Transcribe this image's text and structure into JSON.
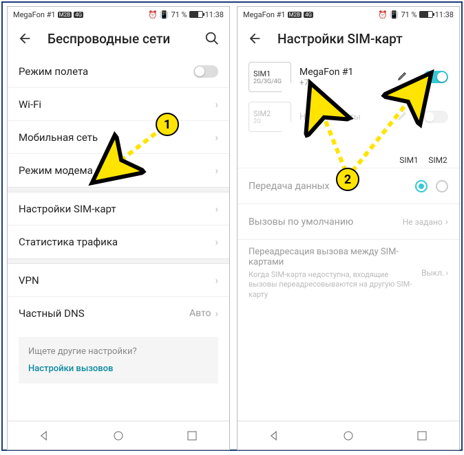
{
  "statusbar": {
    "carrier": "MegaFon #1",
    "badge1": "M2B",
    "badge2": "4G",
    "battery_pct": "71 %",
    "time": "11:38"
  },
  "left": {
    "title": "Беспроводные сети",
    "rows": {
      "airplane": "Режим полета",
      "wifi": "Wi-Fi",
      "mobile": "Мобильная сеть",
      "tether": "Режим модема",
      "sim": "Настройки SIM-карт",
      "traffic": "Статистика трафика",
      "vpn": "VPN",
      "dns": "Частный DNS",
      "dns_value": "Авто"
    },
    "other": {
      "question": "Ищете другие настройки?",
      "link": "Настройки вызовов"
    }
  },
  "right": {
    "title": "Настройки SIM-карт",
    "sim1": {
      "name": "SIM1",
      "type": "2G/3G/4G",
      "carrier": "MegaFon #1",
      "number": "+7"
    },
    "sim2": {
      "name": "SIM2",
      "type": "2G",
      "carrier": "Нет SIM-карты"
    },
    "col1": "SIM1",
    "col2": "SIM2",
    "data_label": "Передача данных",
    "calls_label": "Вызовы по умолчанию",
    "calls_value": "Не задано",
    "forward_title": "Переадресация вызова между SIM-картами",
    "forward_sub": "Когда SIM-карта недоступна, входящие вызовы переадресовываются на другую SIM-карту",
    "forward_value": "Выкл."
  },
  "annotations": {
    "badge1": "1",
    "badge2": "2"
  }
}
